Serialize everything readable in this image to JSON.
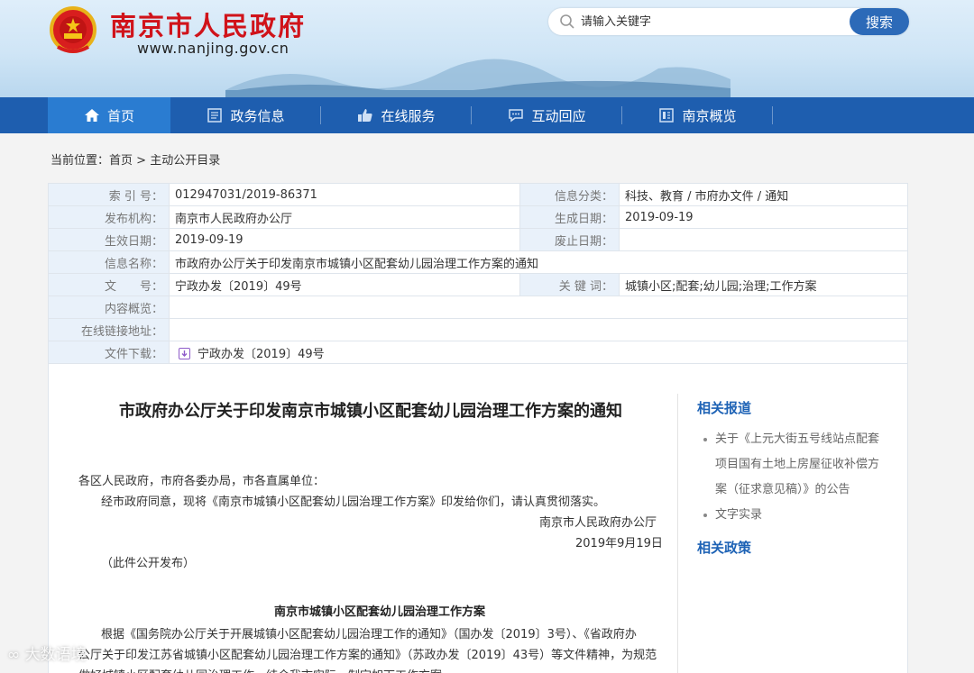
{
  "header": {
    "site_title": "南京市人民政府",
    "site_url": "www.nanjing.gov.cn",
    "search_placeholder": "请输入关键字",
    "search_button": "搜索"
  },
  "nav": [
    {
      "label": "首页",
      "icon": "home-icon"
    },
    {
      "label": "政务信息",
      "icon": "document-icon"
    },
    {
      "label": "在线服务",
      "icon": "thumbs-up-icon"
    },
    {
      "label": "互动回应",
      "icon": "chat-icon"
    },
    {
      "label": "南京概览",
      "icon": "overview-icon"
    }
  ],
  "breadcrumb": {
    "prefix": "当前位置：",
    "home": "首页",
    "sep": " > ",
    "current": "主动公开目录"
  },
  "info": {
    "index_label": "索 引 号：",
    "index_value": "012947031/2019-86371",
    "category_label": "信息分类：",
    "category_value": "科技、教育 / 市府办文件 / 通知",
    "publisher_label": "发布机构：",
    "publisher_value": "南京市人民政府办公厅",
    "created_label": "生成日期：",
    "created_value": "2019-09-19",
    "effective_label": "生效日期：",
    "effective_value": "2019-09-19",
    "abolish_label": "废止日期：",
    "abolish_value": "",
    "name_label": "信息名称：",
    "name_value": "市政府办公厅关于印发南京市城镇小区配套幼儿园治理工作方案的通知",
    "docno_label": "文　　号：",
    "docno_value": "宁政办发〔2019〕49号",
    "keywords_label": "关 键 词：",
    "keywords_value": "城镇小区;配套;幼儿园;治理;工作方案",
    "summary_label": "内容概览：",
    "summary_value": "",
    "link_label": "在线链接地址：",
    "link_value": "",
    "download_label": "文件下载：",
    "download_value": "宁政办发〔2019〕49号"
  },
  "doc": {
    "title": "市政府办公厅关于印发南京市城镇小区配套幼儿园治理工作方案的通知",
    "addressee": "各区人民政府，市府各委办局，市各直属单位：",
    "body": "经市政府同意，现将《南京市城镇小区配套幼儿园治理工作方案》印发给你们，请认真贯彻落实。",
    "issuer": "南京市人民政府办公厅",
    "date": "2019年9月19日",
    "note": "（此件公开发布）",
    "subtitle": "南京市城镇小区配套幼儿园治理工作方案",
    "para1_line1": "根据《国务院办公厅关于开展城镇小区配套幼儿园治理工作的通知》（国办发〔2019〕3号）、《省政府办",
    "para1_line2": "公厅关于印发江苏省城镇小区配套幼儿园治理工作方案的通知》（苏政办发〔2019〕43号）等文件精神，为规范",
    "para1_line3": "做好城镇小区配套幼儿园治理工作，结合我市实际，制定如下工作方案。"
  },
  "sidebar": {
    "related_reports_title": "相关报道",
    "related_reports": [
      "关于《上元大街五号线站点配套",
      "项目国有土地上房屋征收补偿方",
      "案（征求意见稿）》的公告",
      "文字实录"
    ],
    "related_policies_title": "相关政策"
  },
  "watermark": "大数语境"
}
